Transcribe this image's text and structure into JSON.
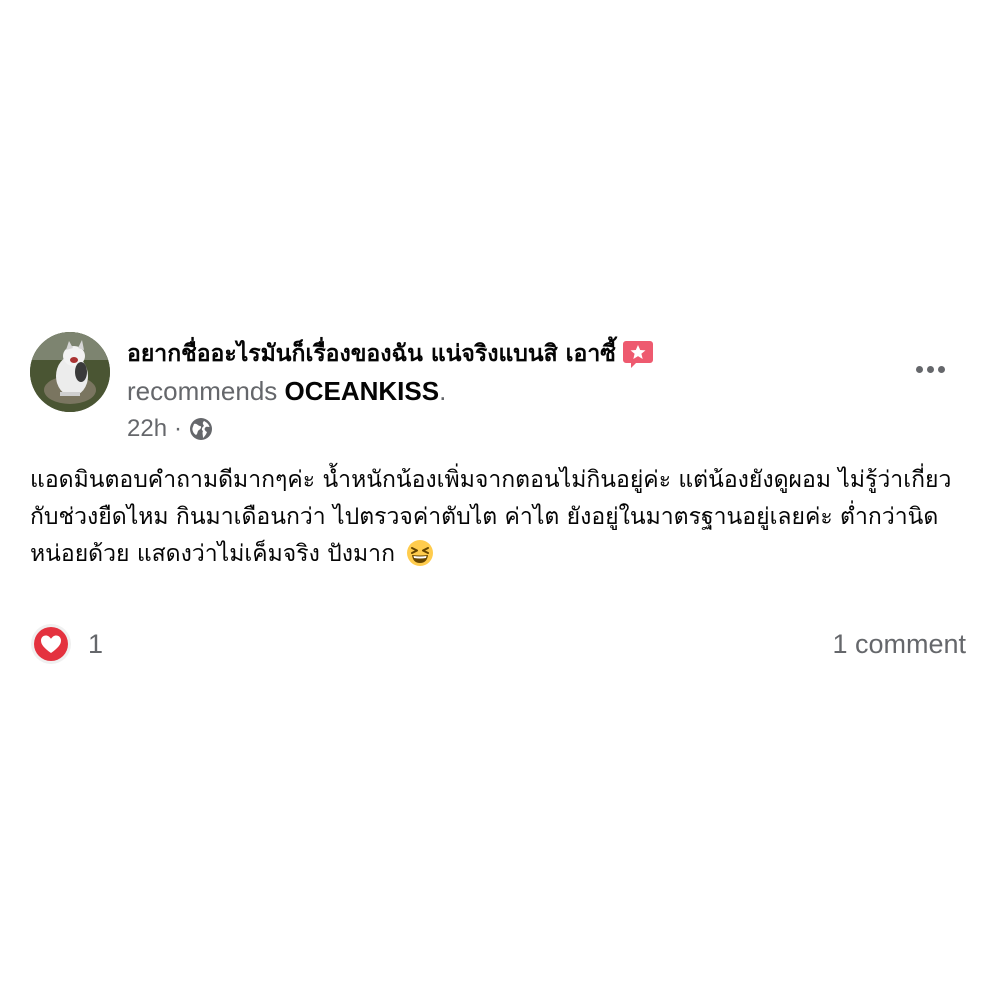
{
  "post": {
    "author": {
      "name": "อยากชื่ออะไรมันก็เรื่องของฉัน แน่จริงแบนสิ เอาซี้",
      "avatar_icon": "avatar-cat-photo",
      "badge_icon": "recommend-star-icon"
    },
    "recommend": {
      "prefix": "recommends",
      "page": "OCEANKISS",
      "suffix": "."
    },
    "meta": {
      "time": "22h",
      "separator": "·",
      "audience_icon": "globe-icon"
    },
    "menu_icon": "more-options-icon",
    "body": {
      "text": "แอดมินตอบคำถามดีมากๆค่ะ น้ำหนักน้องเพิ่มจากตอนไม่กินอยู่ค่ะ แต่น้องยังดูผอม ไม่รู้ว่าเกี่ยวกับช่วงยืดไหม กินมาเดือนกว่า ไปตรวจค่าตับไต ค่าไต ยังอยู่ในมาตรฐานอยู่เลยค่ะ ต่ำกว่านิดหน่อยด้วย แสดงว่าไม่เค็มจริง ปังมาก",
      "emoji": "grinning-squinting-face-icon"
    },
    "footer": {
      "reaction_icon": "love-reaction-icon",
      "reaction_count": "1",
      "comments": "1 comment"
    }
  },
  "colors": {
    "text": "#050505",
    "secondary": "#65676b",
    "love": "#e4323f",
    "badge": "#ee5a6f",
    "background": "#ffffff"
  }
}
